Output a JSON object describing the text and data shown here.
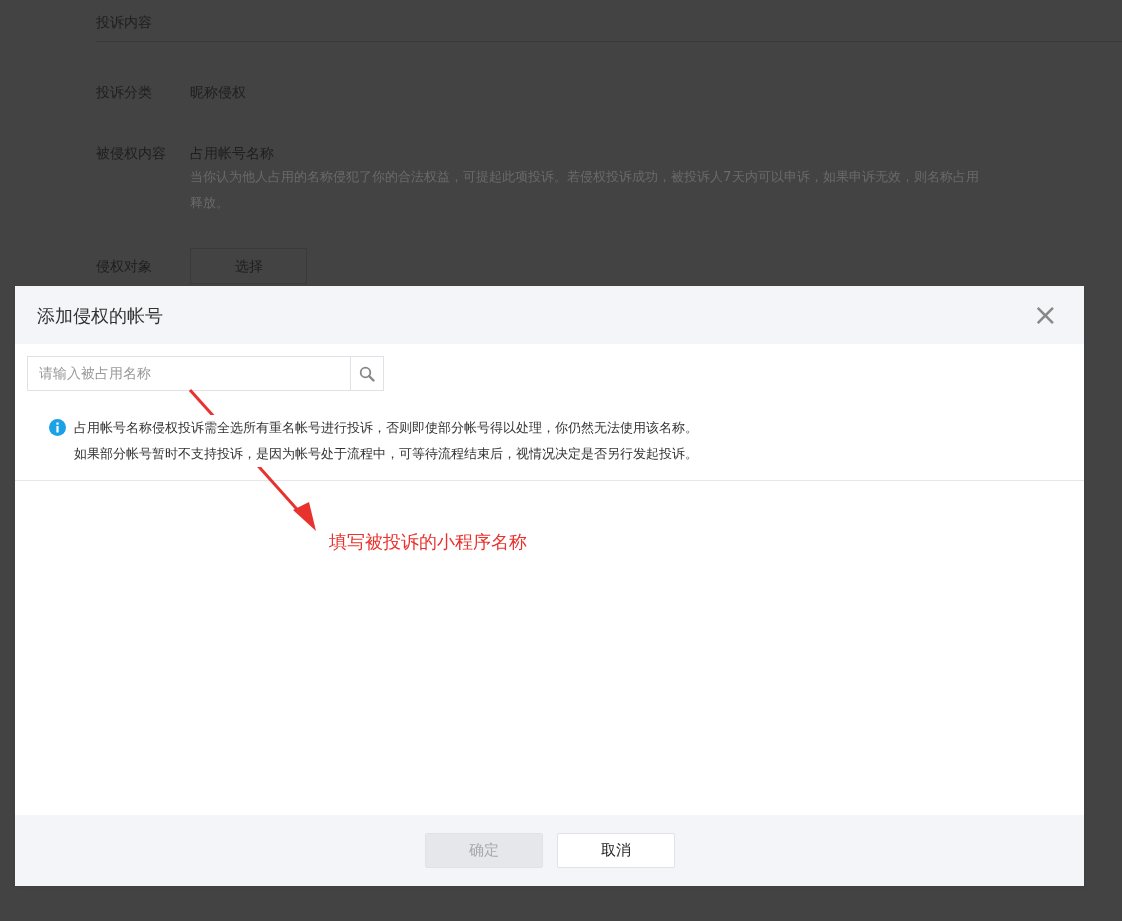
{
  "background_page": {
    "section_title": "投诉内容",
    "fields": [
      {
        "label": "投诉分类",
        "value": "昵称侵权"
      },
      {
        "label": "被侵权内容",
        "value": "占用帐号名称",
        "description_lines": [
          "当你认为他人占用的名称侵犯了你的合法权益，可提起此项投诉。若侵权投诉成功，被投诉人7天内可以申诉，如果申诉无效，则名称占用",
          "释放。"
        ]
      },
      {
        "label": "侵权对象",
        "button": "选择"
      }
    ]
  },
  "dialog": {
    "title": "添加侵权的帐号",
    "close": "×",
    "search": {
      "placeholder": "请输入被占用名称"
    },
    "notice_lines": [
      "占用帐号名称侵权投诉需全选所有重名帐号进行投诉，否则即使部分帐号得以处理，你仍然无法使用该名称。",
      "如果部分帐号暂时不支持投诉，是因为帐号处于流程中，可等待流程结束后，视情况决定是否另行发起投诉。"
    ],
    "buttons": [
      {
        "label": "确定",
        "disabled": true
      },
      {
        "label": "取消",
        "disabled": false
      }
    ]
  },
  "annotation": {
    "text": "填写被投诉的小程序名称"
  }
}
